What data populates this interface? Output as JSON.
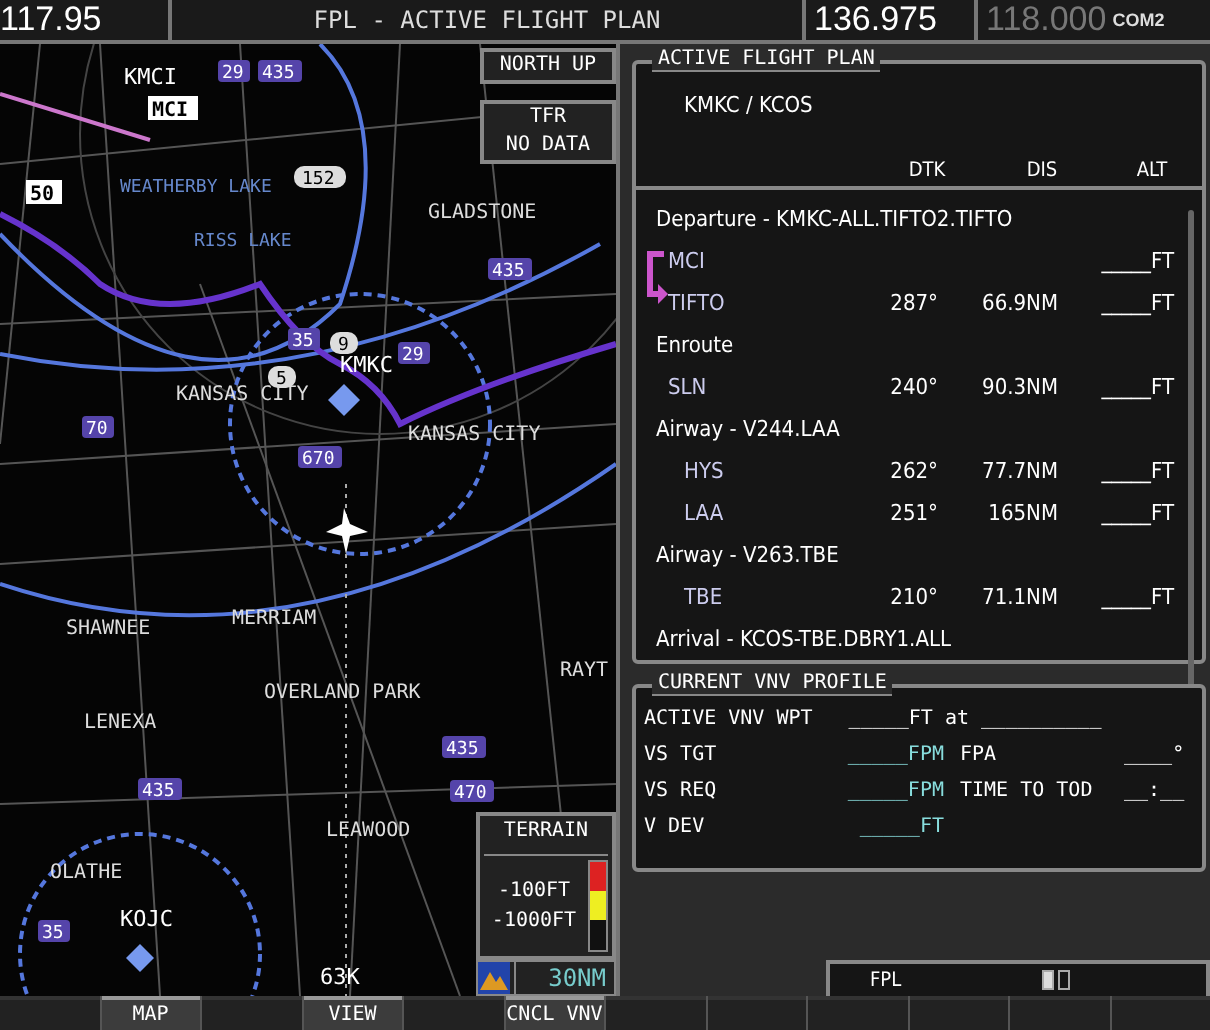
{
  "top_bar": {
    "nav_freq": "117.95",
    "title": "FPL - ACTIVE FLIGHT PLAN",
    "com_active": "136.975",
    "com_standby": "118.000",
    "com_label": "COM2"
  },
  "map": {
    "orientation": "NORTH UP",
    "tfr": "TFR",
    "tfr_status": "NO DATA",
    "labels": [
      {
        "text": "KMCI",
        "kind": "airport"
      },
      {
        "text": "MCI",
        "kind": "boxed"
      },
      {
        "text": "WEATHERBY LAKE",
        "kind": "water"
      },
      {
        "text": "RISS LAKE",
        "kind": "water"
      },
      {
        "text": "GLADSTONE",
        "kind": "city"
      },
      {
        "text": "KMKC",
        "kind": "airport"
      },
      {
        "text": "KANSAS CITY",
        "kind": "city"
      },
      {
        "text": "KANSAS CITY",
        "kind": "city"
      },
      {
        "text": "SHAWNEE",
        "kind": "city"
      },
      {
        "text": "MERRIAM",
        "kind": "city"
      },
      {
        "text": "OVERLAND PARK",
        "kind": "city"
      },
      {
        "text": "RAYT",
        "kind": "city"
      },
      {
        "text": "LENEXA",
        "kind": "city"
      },
      {
        "text": "LEAWOOD",
        "kind": "city"
      },
      {
        "text": "OLATHE",
        "kind": "city"
      },
      {
        "text": "KOJC",
        "kind": "airport"
      },
      {
        "text": "63K",
        "kind": "airport"
      },
      {
        "text": "29",
        "kind": "shield"
      },
      {
        "text": "435",
        "kind": "shield"
      },
      {
        "text": "152",
        "kind": "oval"
      },
      {
        "text": "50",
        "kind": "boxed"
      },
      {
        "text": "435",
        "kind": "shield"
      },
      {
        "text": "35",
        "kind": "shield"
      },
      {
        "text": "9",
        "kind": "oval"
      },
      {
        "text": "5",
        "kind": "oval"
      },
      {
        "text": "29",
        "kind": "shield"
      },
      {
        "text": "70",
        "kind": "shield"
      },
      {
        "text": "670",
        "kind": "shield"
      },
      {
        "text": "435",
        "kind": "shield"
      },
      {
        "text": "435",
        "kind": "shield"
      },
      {
        "text": "470",
        "kind": "shield"
      },
      {
        "text": "35",
        "kind": "shield"
      }
    ],
    "terrain": {
      "title": "TERRAIN",
      "levels": [
        "-100FT",
        "-1000FT"
      ]
    },
    "range": "30NM"
  },
  "flight_plan": {
    "title": "ACTIVE FLIGHT PLAN",
    "route": "KMKC / KCOS",
    "columns": [
      "DTK",
      "DIS",
      "ALT"
    ],
    "rows": [
      {
        "kind": "segment",
        "text": "Departure - KMKC-ALL.TIFTO2.TIFTO"
      },
      {
        "kind": "waypoint",
        "name": "MCI",
        "alt": "_____FT",
        "active_leg": false
      },
      {
        "kind": "waypoint",
        "name": "TIFTO",
        "dtk": "287°",
        "dis": "66.9NM",
        "alt": "_____FT",
        "active_leg": true
      },
      {
        "kind": "segment",
        "text": "Enroute"
      },
      {
        "kind": "waypoint",
        "name": "SLN",
        "dtk": "240°",
        "dis": "90.3NM",
        "alt": "_____FT",
        "active_leg": false
      },
      {
        "kind": "segment",
        "text": "Airway - V244.LAA"
      },
      {
        "kind": "airway_point",
        "name": "HYS",
        "dtk": "262°",
        "dis": "77.7NM",
        "alt": "_____FT",
        "active_leg": false
      },
      {
        "kind": "airway_point",
        "name": "LAA",
        "dtk": "251°",
        "dis": "165NM",
        "alt": "_____FT",
        "active_leg": false
      },
      {
        "kind": "segment",
        "text": "Airway - V263.TBE"
      },
      {
        "kind": "airway_point",
        "name": "TBE",
        "dtk": "210°",
        "dis": "71.1NM",
        "alt": "_____FT",
        "active_leg": false
      },
      {
        "kind": "segment",
        "text": "Arrival - KCOS-TBE.DBRY1.ALL"
      }
    ]
  },
  "vnv_profile": {
    "title": "CURRENT VNV PROFILE",
    "active_wpt_label": "ACTIVE VNV WPT",
    "active_wpt_value": "_____FT at __________",
    "rows": [
      {
        "label": "VS TGT",
        "value": "_____FPM",
        "label2": "FPA",
        "value2": "____°"
      },
      {
        "label": "VS REQ",
        "value": "_____FPM",
        "label2": "TIME TO TOD",
        "value2": "__:__"
      },
      {
        "label": "V DEV",
        "value": "_____FT"
      }
    ]
  },
  "page_group": {
    "name": "FPL",
    "pages": [
      {
        "selected": true
      },
      {
        "selected": false
      }
    ]
  },
  "softkeys": [
    {
      "disabled": true
    },
    {
      "label": "MAP",
      "disabled": false
    },
    {
      "disabled": true
    },
    {
      "label": "VIEW",
      "disabled": false
    },
    {
      "disabled": true
    },
    {
      "label": "CNCL VNV",
      "disabled": false
    },
    {
      "disabled": true
    },
    {
      "disabled": true
    },
    {
      "disabled": true
    },
    {
      "disabled": true
    },
    {
      "disabled": true
    },
    {
      "disabled": true
    }
  ]
}
